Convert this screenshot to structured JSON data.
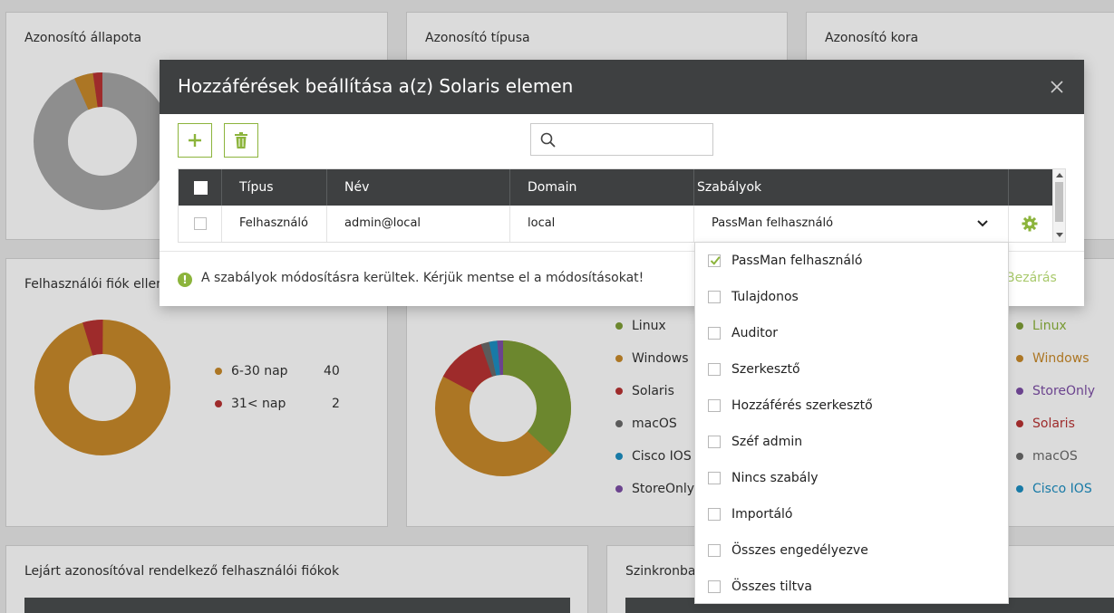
{
  "background": {
    "cards": {
      "status_title": "Azonosító állapota",
      "type_title": "Azonosító típusa",
      "age_title": "Azonosító kora",
      "accounts_title": "Felhasználói fiók ellen",
      "expired_title": "Lejárt azonosítóval rendelkező felhasználói fiókok",
      "sync_title": "Szinkronba"
    },
    "accounts_legend": [
      {
        "label": "6-30 nap",
        "value": "40",
        "color": "#c98a2a"
      },
      {
        "label": "31< nap",
        "value": "2",
        "color": "#b83333"
      }
    ],
    "os_legend_left": [
      {
        "label": "Linux",
        "color": "#7e9e36"
      },
      {
        "label": "Windows",
        "color": "#c98a2a"
      },
      {
        "label": "Solaris",
        "color": "#b83333"
      },
      {
        "label": "macOS",
        "color": "#6b6b6b"
      },
      {
        "label": "Cisco IOS",
        "color": "#1d8fc2"
      },
      {
        "label": "StoreOnly",
        "color": "#7d4ea6"
      }
    ],
    "os_legend_right": [
      {
        "label": "Linux",
        "color": "#7e9e36"
      },
      {
        "label": "Windows",
        "color": "#c98a2a"
      },
      {
        "label": "StoreOnly",
        "color": "#7d4ea6"
      },
      {
        "label": "Solaris",
        "color": "#b83333"
      },
      {
        "label": "macOS",
        "color": "#6b6b6b"
      },
      {
        "label": "Cisco IOS",
        "color": "#1d8fc2"
      }
    ]
  },
  "modal": {
    "title": "Hozzáférések beállítása a(z) Solaris elemen",
    "search_placeholder": "",
    "columns": [
      "Típus",
      "Név",
      "Domain",
      "Szabályok"
    ],
    "row": {
      "type": "Felhasználó",
      "name": "admin@local",
      "domain": "local",
      "rules": "PassMan felhasználó"
    },
    "warning": "A szabályok módosításra kerültek. Kérjük mentse el a módosításokat!",
    "close_label": "Bezárás",
    "accent_color": "#8cb43c"
  },
  "dropdown": {
    "options": [
      {
        "label": "PassMan felhasználó",
        "checked": true
      },
      {
        "label": "Tulajdonos",
        "checked": false
      },
      {
        "label": "Auditor",
        "checked": false
      },
      {
        "label": "Szerkesztő",
        "checked": false
      },
      {
        "label": "Hozzáférés szerkesztő",
        "checked": false
      },
      {
        "label": "Széf admin",
        "checked": false
      },
      {
        "label": "Nincs szabály",
        "checked": false
      },
      {
        "label": "Importáló",
        "checked": false
      },
      {
        "label": "Összes engedélyezve",
        "checked": false
      },
      {
        "label": "Összes tiltva",
        "checked": false
      }
    ]
  }
}
